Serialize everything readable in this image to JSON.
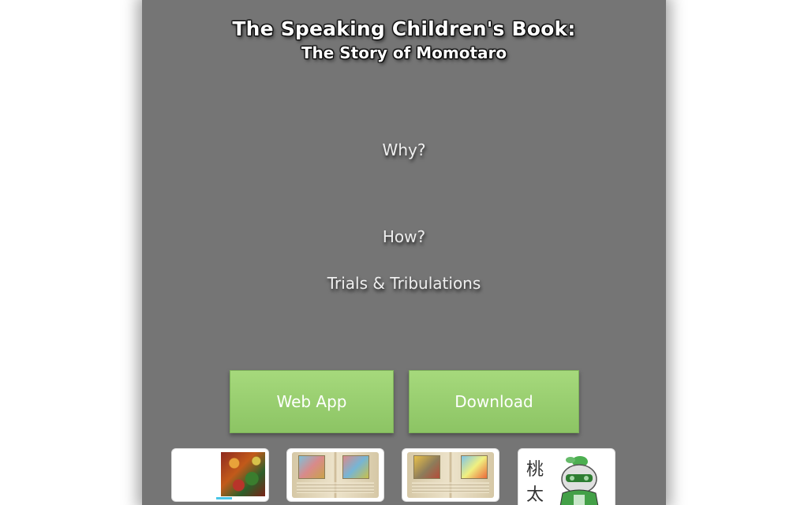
{
  "header": {
    "title": "The Speaking Children's Book:",
    "subtitle": "The Story of Momotaro"
  },
  "nav": {
    "why": "Why?",
    "how": "How?",
    "trials": "Trials & Tribulations"
  },
  "buttons": {
    "web_app": "Web App",
    "download": "Download"
  },
  "thumbnails": {
    "kanji_1": "桃",
    "kanji_2": "太"
  },
  "colors": {
    "panel_background": "#757575",
    "button_green": "#9ad070",
    "title_text": "#ffffff"
  }
}
